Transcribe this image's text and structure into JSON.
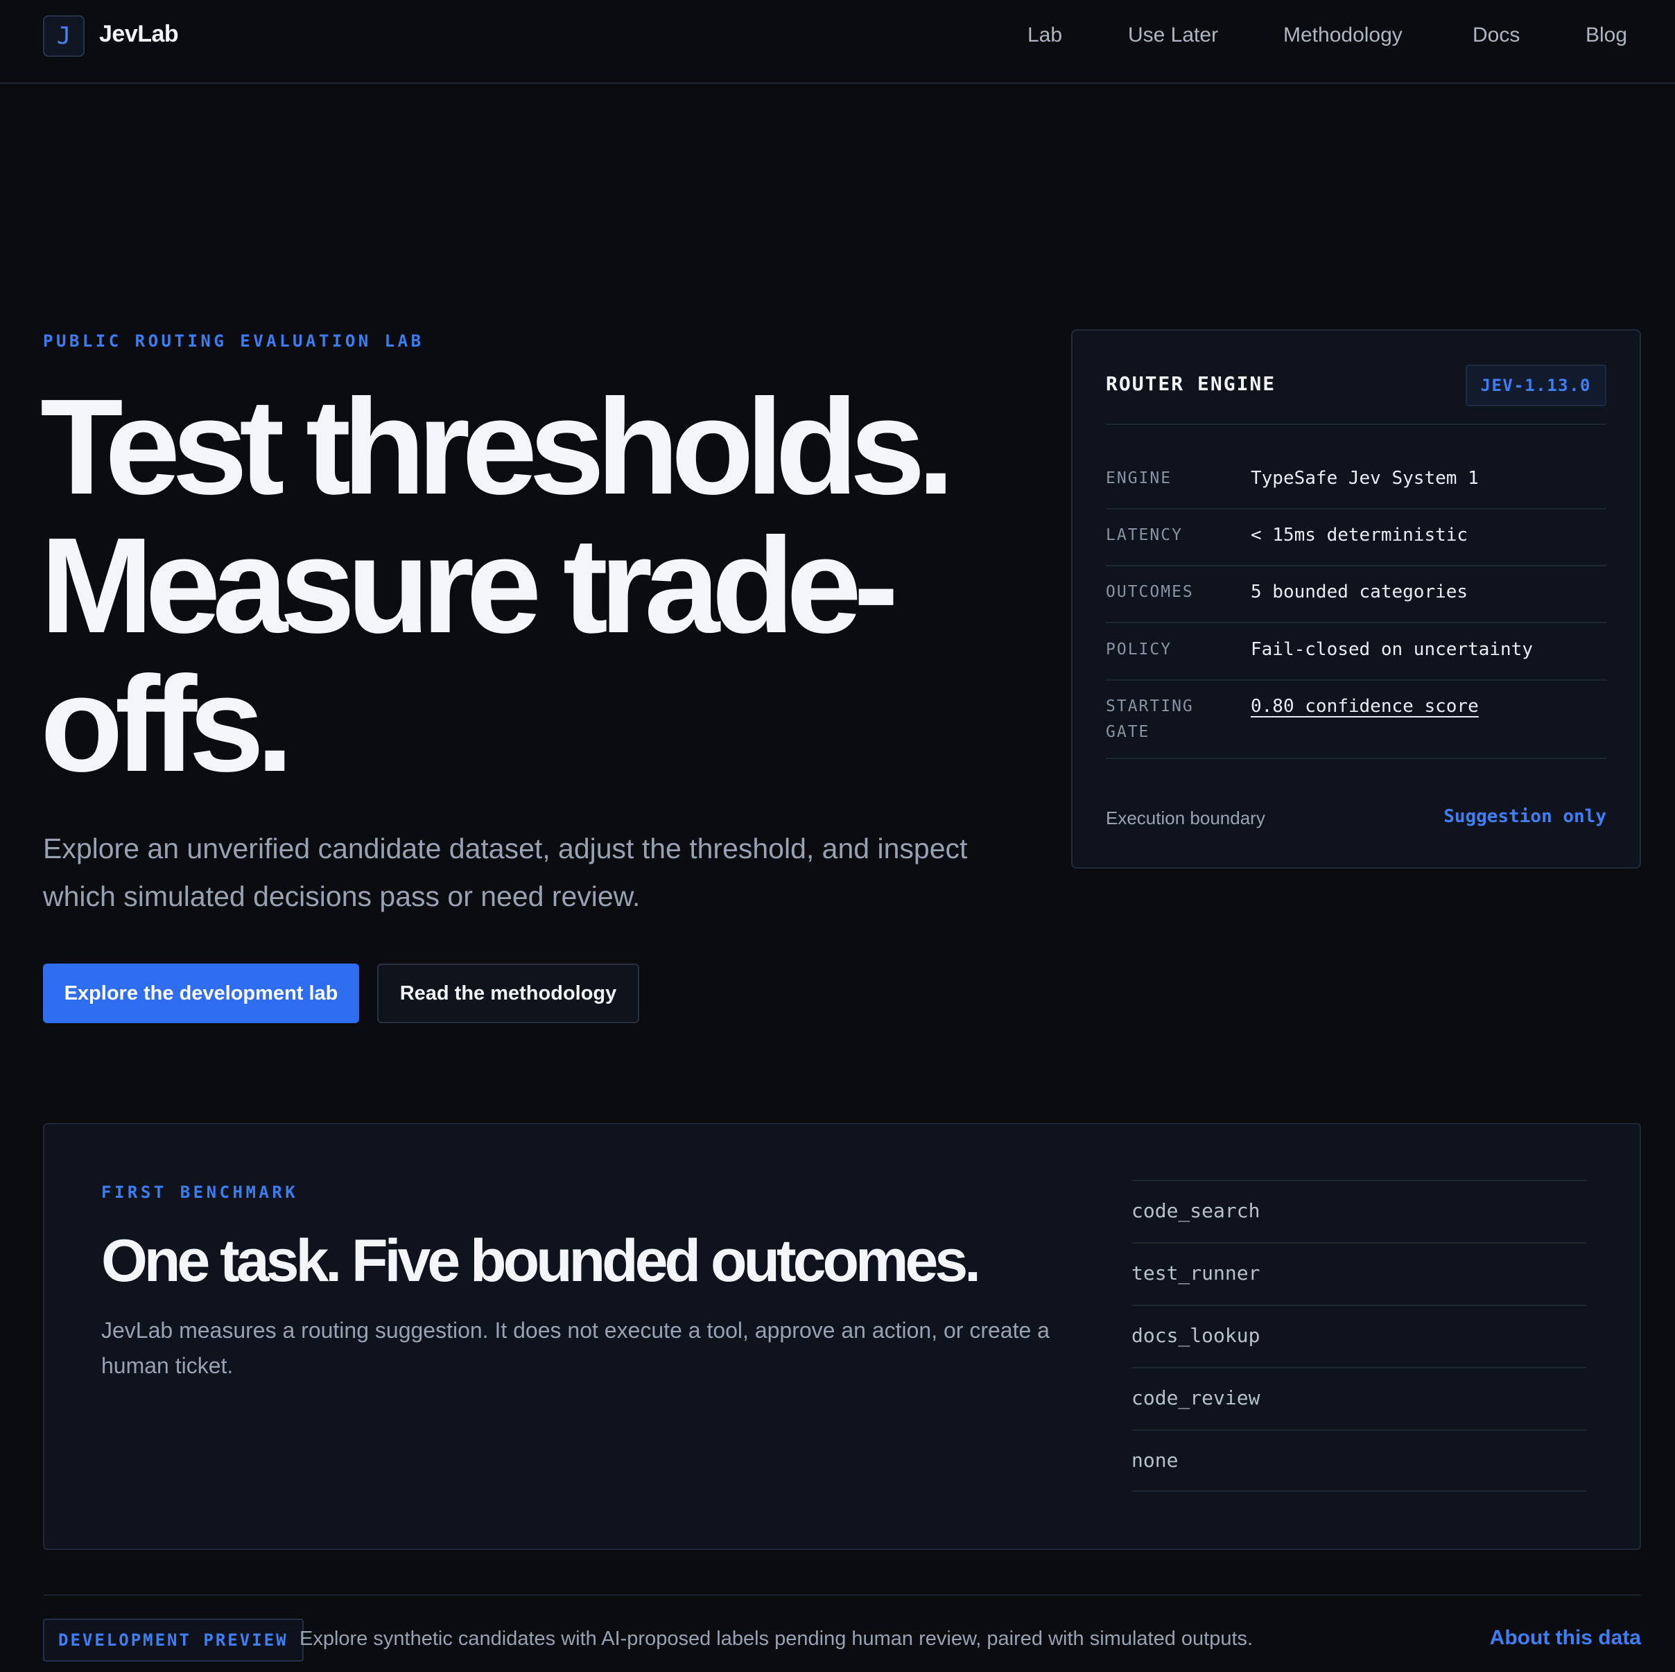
{
  "nav": {
    "logo_letter": "J",
    "brand": "JevLab",
    "links": [
      "Lab",
      "Use Later",
      "Methodology",
      "Docs",
      "Blog"
    ]
  },
  "hero": {
    "eyebrow": "PUBLIC ROUTING EVALUATION LAB",
    "title_lines": [
      "Test thresholds.",
      "Measure trade-",
      "offs."
    ],
    "description": "Explore an unverified candidate dataset, adjust the threshold, and inspect which simulated decisions pass or need review.",
    "primary_button": "Explore the development lab",
    "secondary_button": "Read the methodology"
  },
  "engine_card": {
    "title": "ROUTER ENGINE",
    "version": "JEV-1.13.0",
    "specs": [
      {
        "key": "ENGINE",
        "value": "TypeSafe Jev System 1"
      },
      {
        "key": "LATENCY",
        "value": "< 15ms deterministic"
      },
      {
        "key": "OUTCOMES",
        "value": "5 bounded categories"
      },
      {
        "key": "POLICY",
        "value": "Fail-closed on uncertainty"
      },
      {
        "key": "STARTING GATE",
        "value": "0.80 confidence score"
      }
    ],
    "boundary_label": "Execution boundary",
    "boundary_value": "Suggestion only"
  },
  "benchmark": {
    "eyebrow": "FIRST BENCHMARK",
    "title": "One task. Five bounded outcomes.",
    "description": "JevLab measures a routing suggestion. It does not execute a tool, approve an action, or create a human ticket.",
    "outcomes": [
      "code_search",
      "test_runner",
      "docs_lookup",
      "code_review",
      "none"
    ]
  },
  "strip": {
    "badge": "DEVELOPMENT PREVIEW",
    "text": "Explore synthetic candidates with AI-proposed labels pending human review, paired with simulated outputs.",
    "link": "About this data"
  },
  "colors": {
    "background": "#0a0c10",
    "accent": "#2e6cf0",
    "accent_text": "#3f7ff3",
    "panel": "#0f131d"
  }
}
